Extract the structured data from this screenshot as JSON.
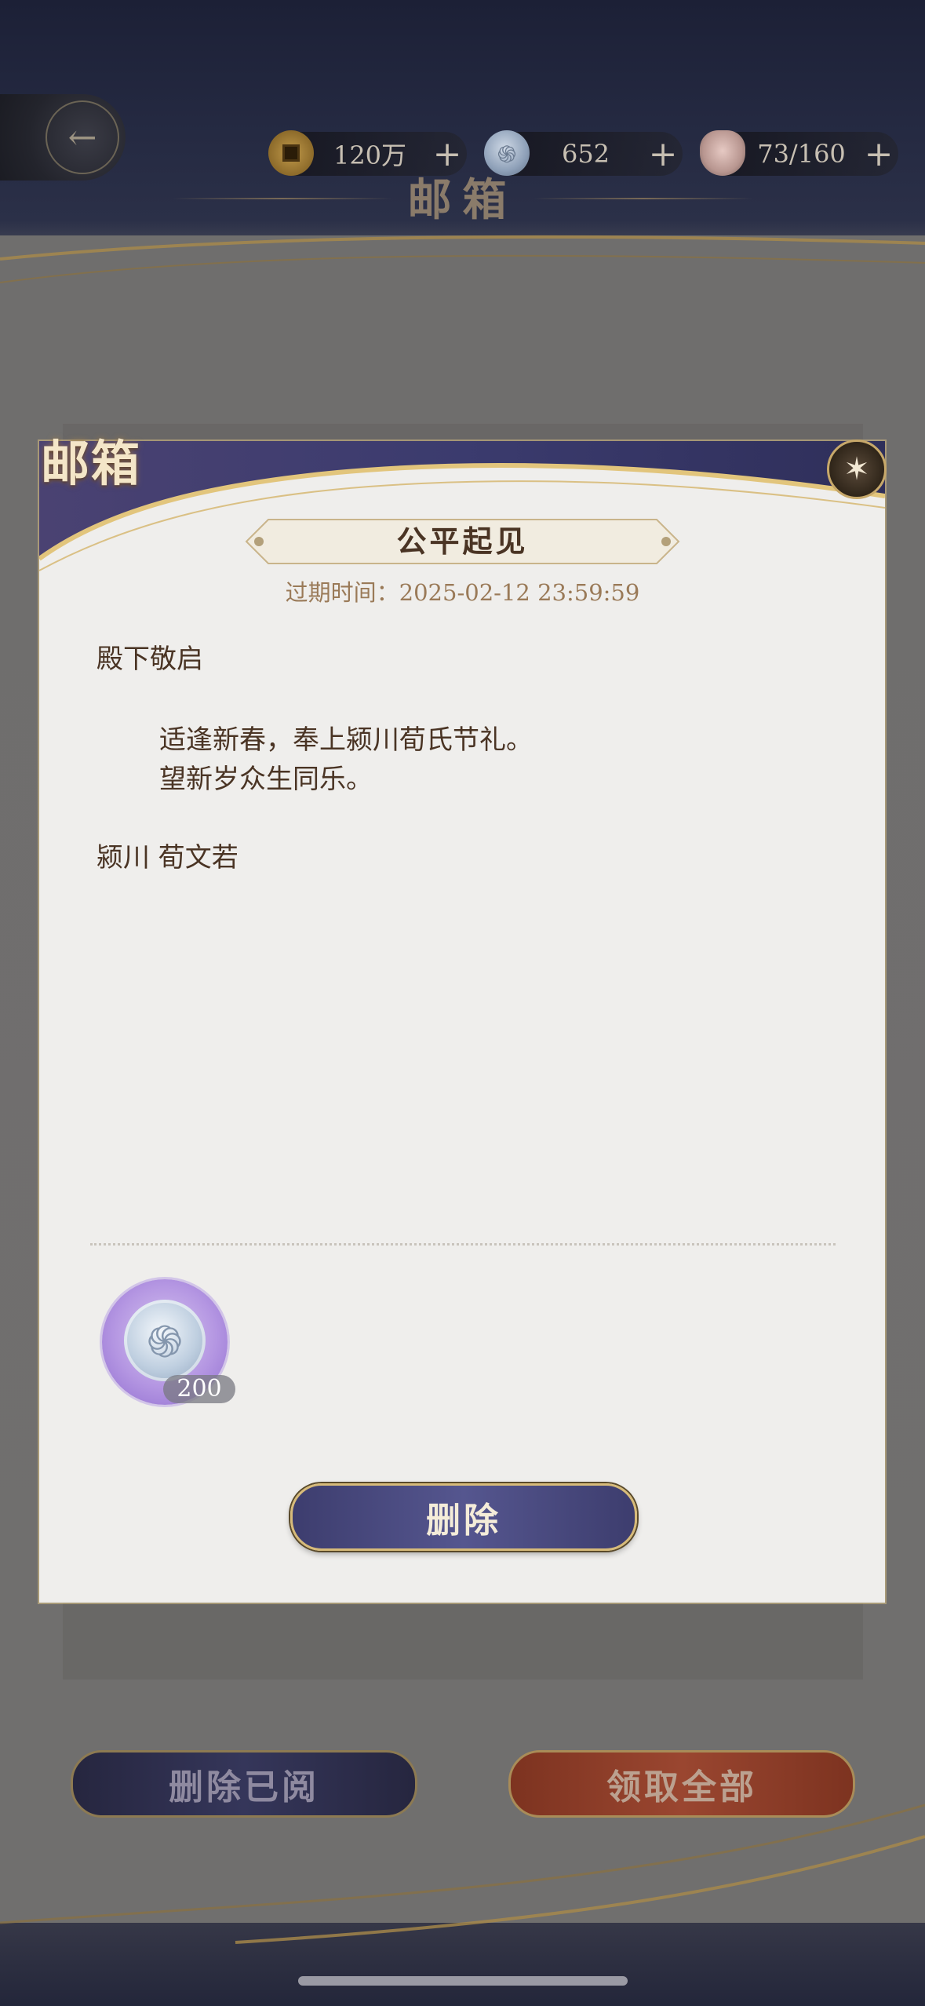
{
  "page": {
    "title": "邮箱"
  },
  "hud": {
    "resources": [
      {
        "name": "copper-coin",
        "icon": "coin-icon",
        "value": "120万",
        "plus": "+"
      },
      {
        "name": "jade",
        "icon": "jade-icon",
        "value": "652",
        "plus": "+"
      },
      {
        "name": "stamina",
        "icon": "bowl-icon",
        "value": "73/160",
        "plus": "+"
      }
    ]
  },
  "modal": {
    "tab_label": "邮箱",
    "mail_title": "公平起见",
    "expire_label": "过期时间：2025-02-12 23:59:59",
    "salutation": "殿下敬启",
    "body_lines": [
      "适逢新春，奉上颍川荀氏节礼。",
      "望新岁众生同乐。"
    ],
    "signature": "颍川 荀文若",
    "rewards": [
      {
        "icon": "jade-icon",
        "quantity": "200"
      }
    ],
    "delete_label": "删除"
  },
  "footer": {
    "delete_read_label": "删除已阅",
    "claim_all_label": "领取全部"
  },
  "colors": {
    "accent_gold": "#d7bb7a",
    "text_brown": "#4a3424",
    "button_purple": "#55568f",
    "button_red": "#9a4630"
  }
}
